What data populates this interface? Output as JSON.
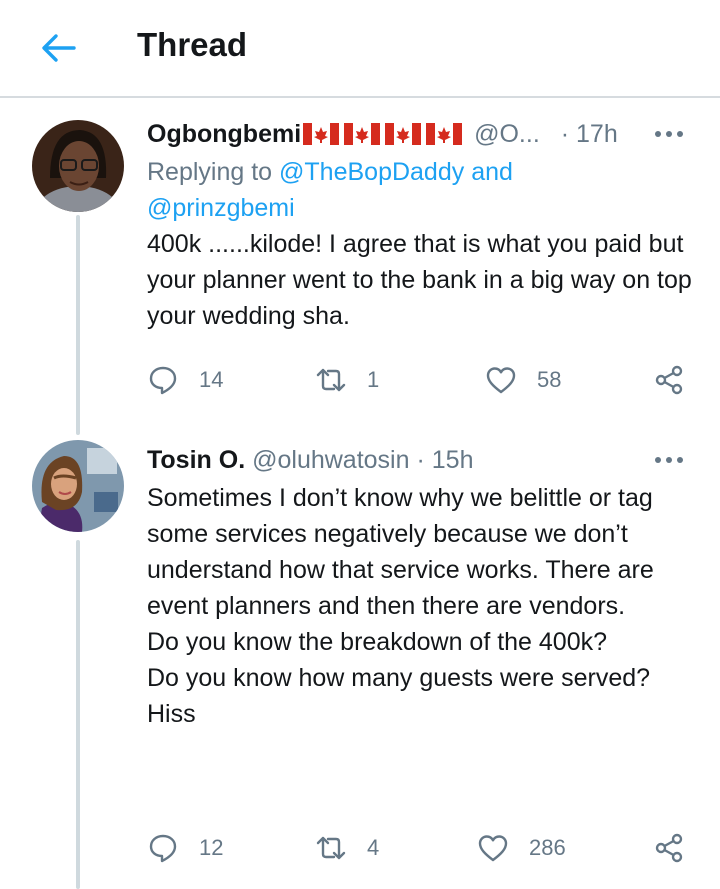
{
  "header": {
    "title": "Thread",
    "back_icon": "arrow-left-icon",
    "accent_color": "#1da1f2"
  },
  "tweets": [
    {
      "display_name": "Ogbongbemi",
      "flags": [
        "canada-flag",
        "canada-flag",
        "canada-flag",
        "canada-flag"
      ],
      "handle": "@O...",
      "separator": "·",
      "time": "17h",
      "replying_prefix": "Replying to ",
      "reply_mention_1": "@TheBopDaddy",
      "reply_and": " and",
      "reply_mention_2": "@prinzgbemi",
      "text": "400k ......kilode! I agree that is what you paid but your planner went to the bank in a big way on top your wedding sha.",
      "replies": "14",
      "retweets": "1",
      "likes": "58"
    },
    {
      "display_name": "Tosin O.",
      "handle": "@oluhwatosin",
      "separator": "·",
      "time": "15h",
      "text": "Sometimes I don’t know why we belittle or tag some services negatively because we don’t understand how that service works. There are event planners and then there are vendors.\nDo you know the breakdown of the 400k?\nDo you know how many guests were served?\nHiss",
      "replies": "12",
      "retweets": "4",
      "likes": "286"
    }
  ]
}
